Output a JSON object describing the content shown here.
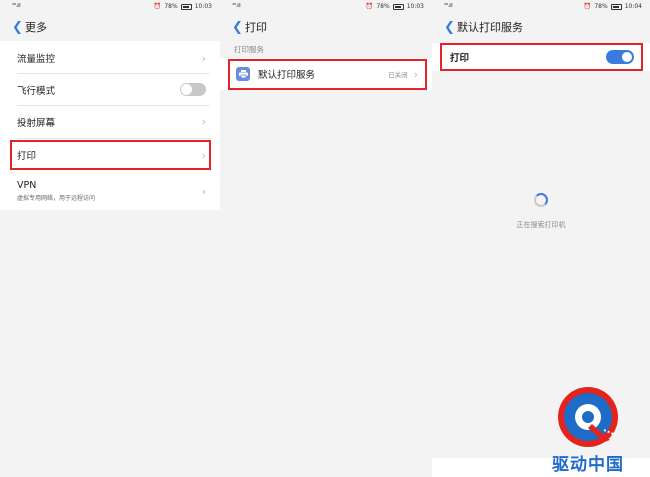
{
  "status_bar": {
    "signal": "⁴ᴳ.ıll",
    "battery_pct": "78%",
    "times": [
      "10:03",
      "10:03",
      "10:04"
    ]
  },
  "panel1": {
    "title": "更多",
    "items": [
      {
        "label": "流量监控"
      },
      {
        "label": "飞行模式"
      },
      {
        "label": "投射屏幕"
      },
      {
        "label": "打印"
      },
      {
        "label": "VPN",
        "sublabel": "虚拟专用网络，用于远程访问"
      }
    ]
  },
  "panel2": {
    "title": "打印",
    "section": "打印服务",
    "service": {
      "label": "默认打印服务",
      "status": "已关闭"
    }
  },
  "panel3": {
    "title": "默认打印服务",
    "toggle_label": "打印",
    "toggle_on": true,
    "searching_text": "正在搜索打印机"
  },
  "watermark": {
    "text": "驱动中国"
  },
  "colors": {
    "accent": "#3b7be0",
    "highlight": "#e0242a",
    "background": "#f3f3f3"
  }
}
